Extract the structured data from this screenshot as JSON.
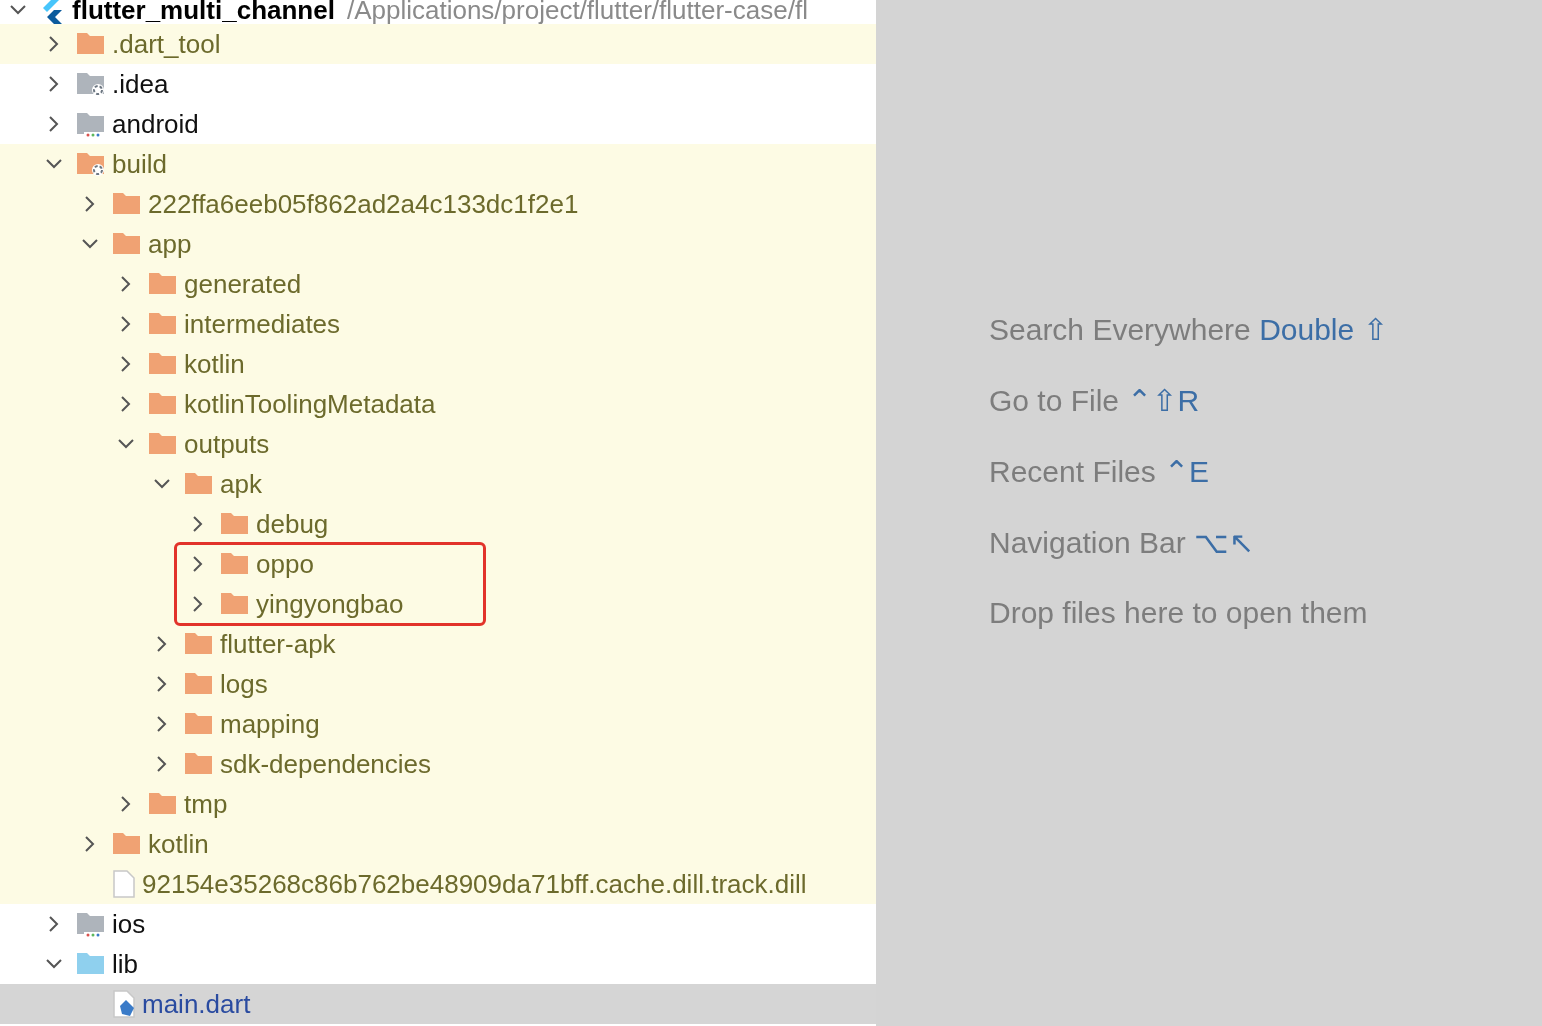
{
  "project_tree": {
    "name": "flutter_multi_channel",
    "path": "/Applications/project/flutter/flutter-case/fl",
    "expanded": true,
    "children": [
      {
        "name": ".dart_tool",
        "kind": "folder",
        "expanded": false,
        "ignored": true,
        "selected": false
      },
      {
        "name": ".idea",
        "kind": "idea-folder",
        "expanded": false,
        "ignored": false,
        "selected": false
      },
      {
        "name": "android",
        "kind": "module-folder",
        "expanded": false,
        "ignored": false,
        "selected": false
      },
      {
        "name": "build",
        "kind": "excluded-folder",
        "expanded": true,
        "ignored": true,
        "selected": false,
        "children": [
          {
            "name": "222ffa6eeb05f862ad2a4c133dc1f2e1",
            "kind": "folder",
            "expanded": false,
            "ignored": true,
            "selected": false
          },
          {
            "name": "app",
            "kind": "folder",
            "expanded": true,
            "ignored": true,
            "selected": false,
            "children": [
              {
                "name": "generated",
                "kind": "folder",
                "expanded": false,
                "ignored": true,
                "selected": false
              },
              {
                "name": "intermediates",
                "kind": "folder",
                "expanded": false,
                "ignored": true,
                "selected": false
              },
              {
                "name": "kotlin",
                "kind": "folder",
                "expanded": false,
                "ignored": true,
                "selected": false
              },
              {
                "name": "kotlinToolingMetadata",
                "kind": "folder",
                "expanded": false,
                "ignored": true,
                "selected": false
              },
              {
                "name": "outputs",
                "kind": "folder",
                "expanded": true,
                "ignored": true,
                "selected": false,
                "children": [
                  {
                    "name": "apk",
                    "kind": "folder",
                    "expanded": true,
                    "ignored": true,
                    "selected": false,
                    "children": [
                      {
                        "name": "debug",
                        "kind": "folder",
                        "expanded": false,
                        "ignored": true,
                        "selected": false,
                        "highlighted": false
                      },
                      {
                        "name": "oppo",
                        "kind": "folder",
                        "expanded": false,
                        "ignored": true,
                        "selected": false,
                        "highlighted": true
                      },
                      {
                        "name": "yingyongbao",
                        "kind": "folder",
                        "expanded": false,
                        "ignored": true,
                        "selected": false,
                        "highlighted": true
                      }
                    ]
                  },
                  {
                    "name": "flutter-apk",
                    "kind": "folder",
                    "expanded": false,
                    "ignored": true,
                    "selected": false
                  },
                  {
                    "name": "logs",
                    "kind": "folder",
                    "expanded": false,
                    "ignored": true,
                    "selected": false
                  },
                  {
                    "name": "mapping",
                    "kind": "folder",
                    "expanded": false,
                    "ignored": true,
                    "selected": false
                  },
                  {
                    "name": "sdk-dependencies",
                    "kind": "folder",
                    "expanded": false,
                    "ignored": true,
                    "selected": false
                  }
                ]
              },
              {
                "name": "tmp",
                "kind": "folder",
                "expanded": false,
                "ignored": true,
                "selected": false
              }
            ]
          },
          {
            "name": "kotlin",
            "kind": "folder",
            "expanded": false,
            "ignored": true,
            "selected": false
          },
          {
            "name": "92154e35268c86b762be48909da71bff.cache.dill.track.dill",
            "kind": "file",
            "ignored": true,
            "selected": false
          }
        ]
      },
      {
        "name": "ios",
        "kind": "module-folder",
        "expanded": false,
        "ignored": false,
        "selected": false
      },
      {
        "name": "lib",
        "kind": "source-folder",
        "expanded": true,
        "ignored": false,
        "selected": false,
        "children": [
          {
            "name": "main.dart",
            "kind": "dart-file",
            "ignored": false,
            "selected": true
          }
        ]
      }
    ]
  },
  "empty_editor_hints": [
    {
      "label": "Search Everywhere",
      "shortcut": "Double ⇧"
    },
    {
      "label": "Go to File",
      "shortcut": "⌃⇧R"
    },
    {
      "label": "Recent Files",
      "shortcut": "⌃E"
    },
    {
      "label": "Navigation Bar",
      "shortcut": "⌥↖"
    },
    {
      "label": "Drop files here to open them"
    }
  ]
}
